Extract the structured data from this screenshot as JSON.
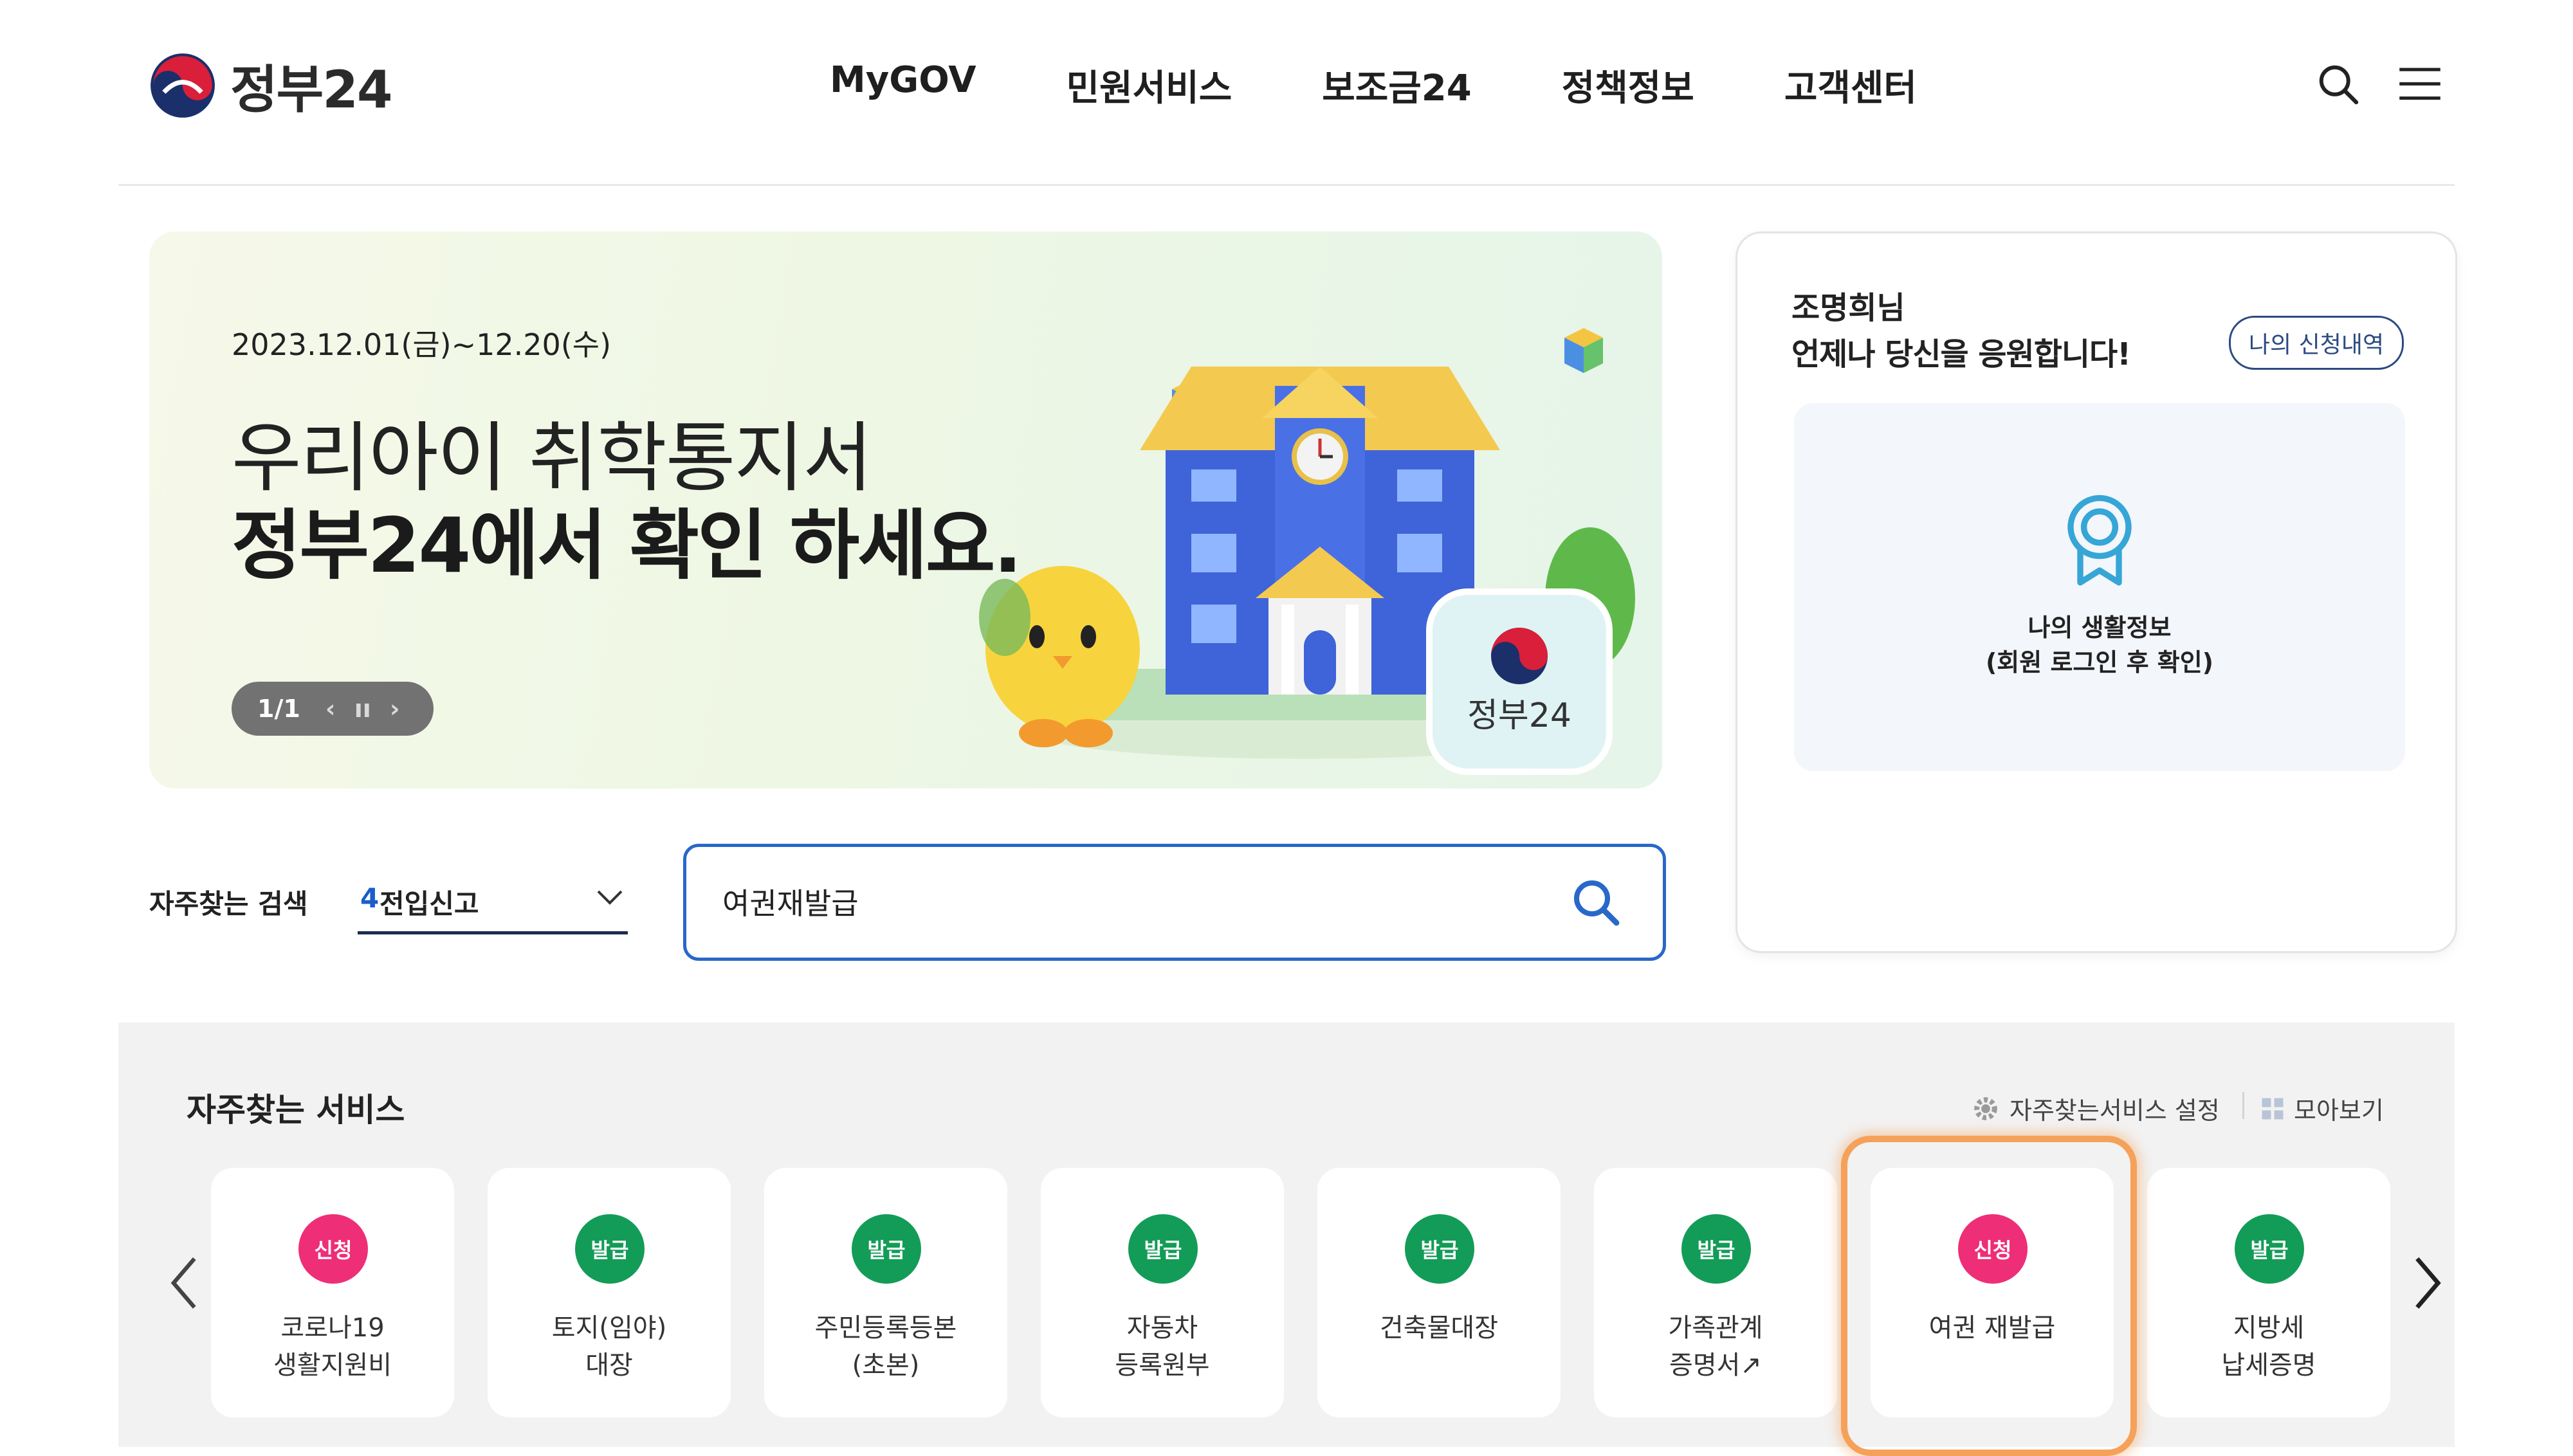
{
  "header": {
    "logo_text": "정부24",
    "nav": [
      "MyGOV",
      "민원서비스",
      "보조금24",
      "정책정보",
      "고객센터"
    ]
  },
  "banner": {
    "date": "2023.12.01(금)~12.20(수)",
    "line1": "우리아이 취학통지서",
    "line2": "정부24에서 확인 하세요.",
    "counter": "1/1",
    "prev_glyph": "‹",
    "pause_glyph": "ıı",
    "next_glyph": "›",
    "badge_text": "정부24"
  },
  "user_panel": {
    "name": "조명희님",
    "message": "언제나 당신을 응원합니다!",
    "history_button": "나의 신청내역",
    "life_line1": "나의 생활정보",
    "life_line2": "(회원 로그인 후 확인)"
  },
  "frequent_search": {
    "label": "자주찾는 검색",
    "rank": "4",
    "term": "전입신고"
  },
  "search": {
    "value": "여권재발급"
  },
  "services": {
    "title": "자주찾는 서비스",
    "settings_label": "자주찾는서비스 설정",
    "view_all_label": "모아보기",
    "items": [
      {
        "badge": "신청",
        "kind": "app",
        "label": "코로나19\n생활지원비"
      },
      {
        "badge": "발급",
        "kind": "iss",
        "label": "토지(임야)\n대장"
      },
      {
        "badge": "발급",
        "kind": "iss",
        "label": "주민등록등본\n(초본)"
      },
      {
        "badge": "발급",
        "kind": "iss",
        "label": "자동차\n등록원부"
      },
      {
        "badge": "발급",
        "kind": "iss",
        "label": "건축물대장"
      },
      {
        "badge": "발급",
        "kind": "iss",
        "label": "가족관계\n증명서↗"
      },
      {
        "badge": "신청",
        "kind": "app",
        "label": "여권 재발급"
      },
      {
        "badge": "발급",
        "kind": "iss",
        "label": "지방세\n납세증명"
      }
    ]
  },
  "colors": {
    "accent_blue": "#2868c9",
    "apply_pink": "#ee2e77",
    "issue_green": "#139c57",
    "highlight_orange": "#f5a15a"
  }
}
